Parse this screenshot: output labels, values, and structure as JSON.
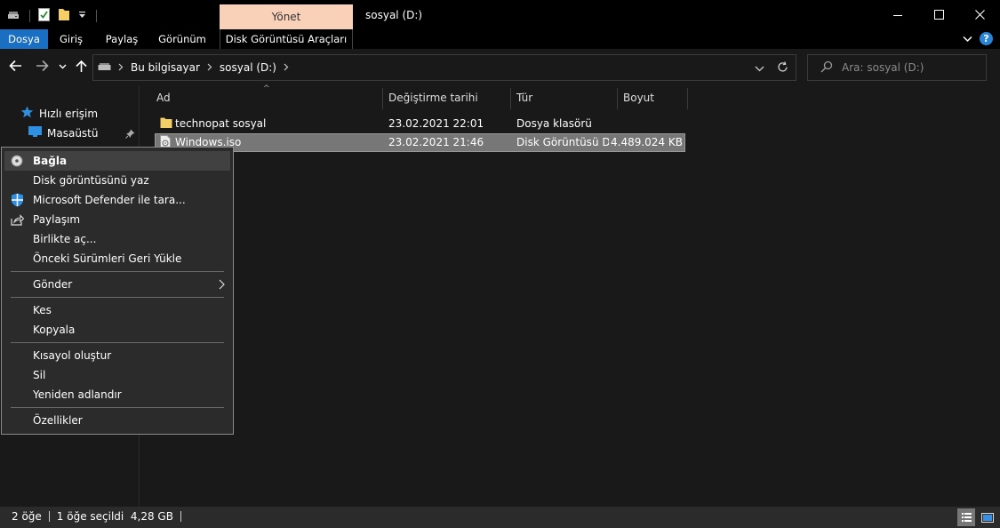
{
  "window": {
    "title": "sosyal (D:)",
    "manage_tab": "Yönet"
  },
  "ribbon": {
    "tabs": [
      "Dosya",
      "Giriş",
      "Paylaş",
      "Görünüm",
      "Disk Görüntüsü Araçları"
    ]
  },
  "address": {
    "crumbs": [
      "Bu bilgisayar",
      "sosyal (D:)"
    ],
    "search_placeholder": "Ara: sosyal (D:)"
  },
  "sidebar": {
    "quick_access": "Hızlı erişim",
    "desktop": "Masaüstü"
  },
  "columns": [
    "Ad",
    "Değiştirme tarihi",
    "Tür",
    "Boyut"
  ],
  "files": [
    {
      "name": "technopat sosyal",
      "modified": "23.02.2021 22:01",
      "type": "Dosya klasörü",
      "size": ""
    },
    {
      "name": "Windows.iso",
      "modified": "23.02.2021 21:46",
      "type": "Disk Görüntüsü D...",
      "size": "4.489.024 KB"
    }
  ],
  "context_menu": {
    "items": [
      {
        "label": "Bağla",
        "icon": "disc-icon"
      },
      {
        "label": "Disk görüntüsünü yaz"
      },
      {
        "label": "Microsoft Defender ile tara...",
        "icon": "defender-shield-icon"
      },
      {
        "label": "Paylaşım",
        "icon": "share-icon"
      },
      {
        "label": "Birlikte aç..."
      },
      {
        "label": "Önceki Sürümleri Geri Yükle"
      },
      {
        "label": "Gönder"
      },
      {
        "label": "Kes"
      },
      {
        "label": "Kopyala"
      },
      {
        "label": "Kısayol oluştur"
      },
      {
        "label": "Sil"
      },
      {
        "label": "Yeniden adlandır"
      },
      {
        "label": "Özellikler"
      }
    ]
  },
  "status": {
    "item_count": "2 öğe",
    "selection": "1 öğe seçildi  4,28 GB"
  },
  "colors": {
    "accent": "#1a6fc2",
    "manage_tab_bg": "#f9d1b8",
    "background": "#191919"
  }
}
